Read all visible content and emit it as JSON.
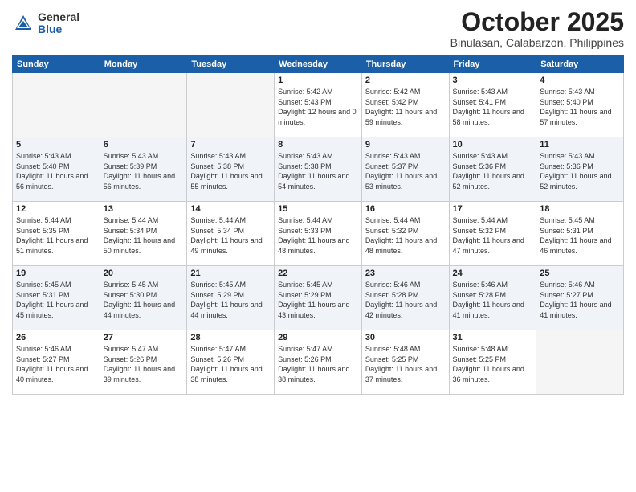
{
  "header": {
    "logo_general": "General",
    "logo_blue": "Blue",
    "month_title": "October 2025",
    "location": "Binulasan, Calabarzon, Philippines"
  },
  "weekdays": [
    "Sunday",
    "Monday",
    "Tuesday",
    "Wednesday",
    "Thursday",
    "Friday",
    "Saturday"
  ],
  "weeks": [
    [
      {
        "day": "",
        "sunrise": "",
        "sunset": "",
        "daylight": ""
      },
      {
        "day": "",
        "sunrise": "",
        "sunset": "",
        "daylight": ""
      },
      {
        "day": "",
        "sunrise": "",
        "sunset": "",
        "daylight": ""
      },
      {
        "day": "1",
        "sunrise": "Sunrise: 5:42 AM",
        "sunset": "Sunset: 5:43 PM",
        "daylight": "Daylight: 12 hours and 0 minutes."
      },
      {
        "day": "2",
        "sunrise": "Sunrise: 5:42 AM",
        "sunset": "Sunset: 5:42 PM",
        "daylight": "Daylight: 11 hours and 59 minutes."
      },
      {
        "day": "3",
        "sunrise": "Sunrise: 5:43 AM",
        "sunset": "Sunset: 5:41 PM",
        "daylight": "Daylight: 11 hours and 58 minutes."
      },
      {
        "day": "4",
        "sunrise": "Sunrise: 5:43 AM",
        "sunset": "Sunset: 5:40 PM",
        "daylight": "Daylight: 11 hours and 57 minutes."
      }
    ],
    [
      {
        "day": "5",
        "sunrise": "Sunrise: 5:43 AM",
        "sunset": "Sunset: 5:40 PM",
        "daylight": "Daylight: 11 hours and 56 minutes."
      },
      {
        "day": "6",
        "sunrise": "Sunrise: 5:43 AM",
        "sunset": "Sunset: 5:39 PM",
        "daylight": "Daylight: 11 hours and 56 minutes."
      },
      {
        "day": "7",
        "sunrise": "Sunrise: 5:43 AM",
        "sunset": "Sunset: 5:38 PM",
        "daylight": "Daylight: 11 hours and 55 minutes."
      },
      {
        "day": "8",
        "sunrise": "Sunrise: 5:43 AM",
        "sunset": "Sunset: 5:38 PM",
        "daylight": "Daylight: 11 hours and 54 minutes."
      },
      {
        "day": "9",
        "sunrise": "Sunrise: 5:43 AM",
        "sunset": "Sunset: 5:37 PM",
        "daylight": "Daylight: 11 hours and 53 minutes."
      },
      {
        "day": "10",
        "sunrise": "Sunrise: 5:43 AM",
        "sunset": "Sunset: 5:36 PM",
        "daylight": "Daylight: 11 hours and 52 minutes."
      },
      {
        "day": "11",
        "sunrise": "Sunrise: 5:43 AM",
        "sunset": "Sunset: 5:36 PM",
        "daylight": "Daylight: 11 hours and 52 minutes."
      }
    ],
    [
      {
        "day": "12",
        "sunrise": "Sunrise: 5:44 AM",
        "sunset": "Sunset: 5:35 PM",
        "daylight": "Daylight: 11 hours and 51 minutes."
      },
      {
        "day": "13",
        "sunrise": "Sunrise: 5:44 AM",
        "sunset": "Sunset: 5:34 PM",
        "daylight": "Daylight: 11 hours and 50 minutes."
      },
      {
        "day": "14",
        "sunrise": "Sunrise: 5:44 AM",
        "sunset": "Sunset: 5:34 PM",
        "daylight": "Daylight: 11 hours and 49 minutes."
      },
      {
        "day": "15",
        "sunrise": "Sunrise: 5:44 AM",
        "sunset": "Sunset: 5:33 PM",
        "daylight": "Daylight: 11 hours and 48 minutes."
      },
      {
        "day": "16",
        "sunrise": "Sunrise: 5:44 AM",
        "sunset": "Sunset: 5:32 PM",
        "daylight": "Daylight: 11 hours and 48 minutes."
      },
      {
        "day": "17",
        "sunrise": "Sunrise: 5:44 AM",
        "sunset": "Sunset: 5:32 PM",
        "daylight": "Daylight: 11 hours and 47 minutes."
      },
      {
        "day": "18",
        "sunrise": "Sunrise: 5:45 AM",
        "sunset": "Sunset: 5:31 PM",
        "daylight": "Daylight: 11 hours and 46 minutes."
      }
    ],
    [
      {
        "day": "19",
        "sunrise": "Sunrise: 5:45 AM",
        "sunset": "Sunset: 5:31 PM",
        "daylight": "Daylight: 11 hours and 45 minutes."
      },
      {
        "day": "20",
        "sunrise": "Sunrise: 5:45 AM",
        "sunset": "Sunset: 5:30 PM",
        "daylight": "Daylight: 11 hours and 44 minutes."
      },
      {
        "day": "21",
        "sunrise": "Sunrise: 5:45 AM",
        "sunset": "Sunset: 5:29 PM",
        "daylight": "Daylight: 11 hours and 44 minutes."
      },
      {
        "day": "22",
        "sunrise": "Sunrise: 5:45 AM",
        "sunset": "Sunset: 5:29 PM",
        "daylight": "Daylight: 11 hours and 43 minutes."
      },
      {
        "day": "23",
        "sunrise": "Sunrise: 5:46 AM",
        "sunset": "Sunset: 5:28 PM",
        "daylight": "Daylight: 11 hours and 42 minutes."
      },
      {
        "day": "24",
        "sunrise": "Sunrise: 5:46 AM",
        "sunset": "Sunset: 5:28 PM",
        "daylight": "Daylight: 11 hours and 41 minutes."
      },
      {
        "day": "25",
        "sunrise": "Sunrise: 5:46 AM",
        "sunset": "Sunset: 5:27 PM",
        "daylight": "Daylight: 11 hours and 41 minutes."
      }
    ],
    [
      {
        "day": "26",
        "sunrise": "Sunrise: 5:46 AM",
        "sunset": "Sunset: 5:27 PM",
        "daylight": "Daylight: 11 hours and 40 minutes."
      },
      {
        "day": "27",
        "sunrise": "Sunrise: 5:47 AM",
        "sunset": "Sunset: 5:26 PM",
        "daylight": "Daylight: 11 hours and 39 minutes."
      },
      {
        "day": "28",
        "sunrise": "Sunrise: 5:47 AM",
        "sunset": "Sunset: 5:26 PM",
        "daylight": "Daylight: 11 hours and 38 minutes."
      },
      {
        "day": "29",
        "sunrise": "Sunrise: 5:47 AM",
        "sunset": "Sunset: 5:26 PM",
        "daylight": "Daylight: 11 hours and 38 minutes."
      },
      {
        "day": "30",
        "sunrise": "Sunrise: 5:48 AM",
        "sunset": "Sunset: 5:25 PM",
        "daylight": "Daylight: 11 hours and 37 minutes."
      },
      {
        "day": "31",
        "sunrise": "Sunrise: 5:48 AM",
        "sunset": "Sunset: 5:25 PM",
        "daylight": "Daylight: 11 hours and 36 minutes."
      },
      {
        "day": "",
        "sunrise": "",
        "sunset": "",
        "daylight": ""
      }
    ]
  ]
}
